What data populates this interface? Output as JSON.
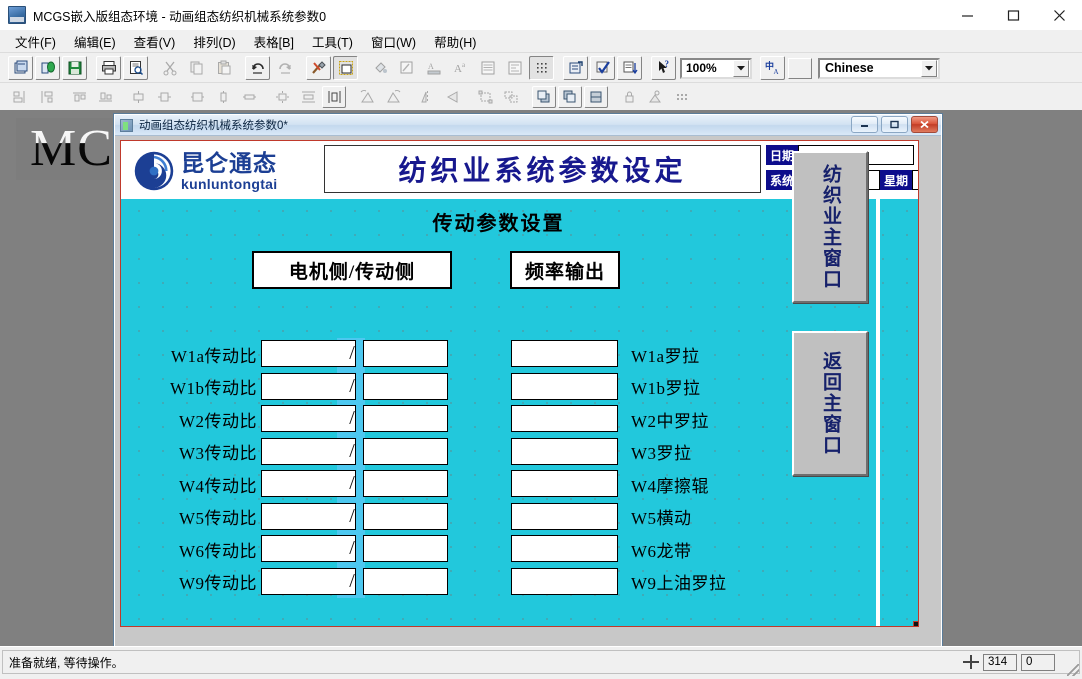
{
  "window": {
    "title": "MCGS嵌入版组态环境 - 动画组态纺织机械系统参数0",
    "icon": "mcgs-app-icon",
    "minimize": "—",
    "maximize": "□",
    "close": "✕"
  },
  "menu": [
    {
      "label": "文件(F)",
      "name": "menu-file"
    },
    {
      "label": "编辑(E)",
      "name": "menu-edit"
    },
    {
      "label": "查看(V)",
      "name": "menu-view"
    },
    {
      "label": "排列(D)",
      "name": "menu-arrange"
    },
    {
      "label": "表格[B]",
      "name": "menu-table"
    },
    {
      "label": "工具(T)",
      "name": "menu-tools"
    },
    {
      "label": "窗口(W)",
      "name": "menu-window"
    },
    {
      "label": "帮助(H)",
      "name": "menu-help"
    }
  ],
  "toolbar": {
    "zoom_value": "100%",
    "language_value": "Chinese",
    "row1_icons": [
      "new-window-icon",
      "open-database-icon",
      "save-icon",
      "print-icon",
      "print-preview-icon",
      "cut-icon",
      "copy-icon",
      "paste-icon",
      "undo-icon",
      "redo-icon",
      "tools-icon",
      "window-properties-icon",
      "fill-color-icon",
      "line-color-icon",
      "text-color-icon",
      "font-icon",
      "align-text-icon",
      "paragraph-icon",
      "grid-icon",
      "object-properties-icon",
      "check-icon",
      "sort-icon",
      "help-pointer-icon",
      "input-method-icon"
    ],
    "row2_icons": [
      "align-left-icon",
      "align-right-icon",
      "align-top-icon",
      "align-bottom-icon",
      "center-vertical-icon",
      "center-horizontal-icon",
      "same-size-icon",
      "same-height-icon",
      "same-width-icon",
      "space-even-icon",
      "space-vertical-icon",
      "space-horizontal-icon",
      "rotate-left-icon",
      "rotate-right-icon",
      "flip-vertical-icon",
      "flip-horizontal-icon",
      "group-icon",
      "ungroup-icon",
      "bring-front-icon",
      "send-back-icon",
      "layer-icon",
      "lock-icon",
      "unlock-icon",
      "dots-icon"
    ]
  },
  "watermark": "MC",
  "child_window": {
    "title": "动画组态纺织机械系统参数0*",
    "icon": "document-icon",
    "minimize": "minimize-icon",
    "restore": "restore-icon",
    "close": "close-icon"
  },
  "hmi": {
    "logo": {
      "mark": "kunluntongtai-swirl-logo",
      "cn": "昆仑通态",
      "en": "kunluntongtai",
      "color": "#1c3f94"
    },
    "page_title": "纺织业系统参数设定",
    "page_title_color": "#17188e",
    "status_panel": {
      "date_label": "日期",
      "date_value": "",
      "runtime_label": "系统已运行",
      "runtime_value": "",
      "weekday_label": "星期",
      "weekday_value": "",
      "label_bg": "#0d0d8c"
    },
    "section_title": "传动参数设置",
    "column_headers": {
      "motor_drive": "电机侧/传动侧",
      "frequency_out": "频率输出"
    },
    "separator": "/",
    "background_color": "#22c8dc",
    "slash_band_color": "#4dc8f0",
    "rows": [
      {
        "label": "W1a传动比",
        "numerator": "",
        "denominator": "",
        "frequency": "",
        "target": "W1a罗拉"
      },
      {
        "label": "W1b传动比",
        "numerator": "",
        "denominator": "",
        "frequency": "",
        "target": "W1b罗拉"
      },
      {
        "label": "W2传动比",
        "numerator": "",
        "denominator": "",
        "frequency": "",
        "target": "W2中罗拉"
      },
      {
        "label": "W3传动比",
        "numerator": "",
        "denominator": "",
        "frequency": "",
        "target": "W3罗拉"
      },
      {
        "label": "W4传动比",
        "numerator": "",
        "denominator": "",
        "frequency": "",
        "target": "W4摩擦辊"
      },
      {
        "label": "W5传动比",
        "numerator": "",
        "denominator": "",
        "frequency": "",
        "target": "W5横动"
      },
      {
        "label": "W6传动比",
        "numerator": "",
        "denominator": "",
        "frequency": "",
        "target": "W6龙带"
      },
      {
        "label": "W9传动比",
        "numerator": "",
        "denominator": "",
        "frequency": "",
        "target": "W9上油罗拉"
      }
    ],
    "nav_buttons": [
      {
        "label": "纺织业主窗口",
        "name": "nav-textile-main-window"
      },
      {
        "label": "返回主窗口",
        "name": "nav-back-main-window"
      }
    ]
  },
  "statusbar": {
    "message": "准备就绪, 等待操作。",
    "coord_icon": "crosshair-icon",
    "coord_x": "314",
    "coord_y": "0"
  }
}
